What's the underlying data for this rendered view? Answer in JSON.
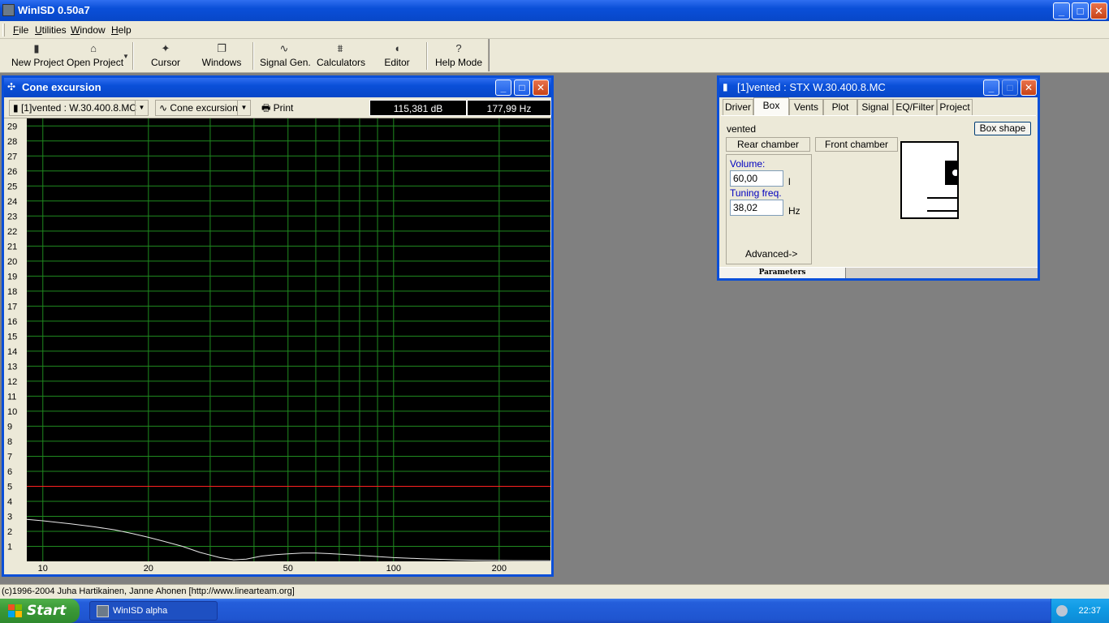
{
  "app": {
    "title": "WinISD 0.50a7",
    "min": "_",
    "max": "□",
    "close": "✕"
  },
  "menu": [
    "File",
    "Utilities",
    "Window",
    "Help"
  ],
  "toolbar": {
    "new_project": "New Project",
    "open_project": "Open Project",
    "cursor": "Cursor",
    "windows": "Windows",
    "signal_gen": "Signal Gen.",
    "calculators": "Calculators",
    "editor": "Editor",
    "help_mode": "Help Mode"
  },
  "graph_window": {
    "title": "Cone excursion",
    "project_select": "[1]vented : W.30.400.8.MC",
    "graph_select": "Cone excursion",
    "print": "Print",
    "readout_db": "115,381 dB",
    "readout_hz": "177,99 Hz"
  },
  "chart_data": {
    "type": "line",
    "title": "",
    "xlabel": "",
    "ylabel": "",
    "x_scale": "log",
    "xlim": [
      9,
      280
    ],
    "ylim": [
      0,
      29.5
    ],
    "x_ticks": [
      10,
      20,
      50,
      100,
      200
    ],
    "y_ticks": [
      1,
      2,
      3,
      4,
      5,
      6,
      7,
      8,
      9,
      10,
      11,
      12,
      13,
      14,
      15,
      16,
      17,
      18,
      19,
      20,
      21,
      22,
      23,
      24,
      25,
      26,
      27,
      28,
      29
    ],
    "grid": true,
    "background": "#000000",
    "grid_color": "#1f8a1f",
    "limit_line": {
      "y": 5,
      "color": "#ff2020"
    },
    "series": [
      {
        "color": "#e8e8e8",
        "x": [
          9,
          10,
          12,
          14,
          16,
          18,
          20,
          22,
          25,
          28,
          32,
          35,
          38,
          42,
          46,
          50,
          55,
          60,
          65,
          70,
          75,
          80,
          90,
          100,
          120,
          150,
          180,
          220,
          280
        ],
        "y": [
          2.8,
          2.7,
          2.5,
          2.3,
          2.1,
          1.85,
          1.6,
          1.35,
          1.0,
          0.6,
          0.25,
          0.1,
          0.15,
          0.35,
          0.45,
          0.5,
          0.55,
          0.55,
          0.52,
          0.48,
          0.44,
          0.4,
          0.32,
          0.25,
          0.18,
          0.1,
          0.07,
          0.05,
          0.04
        ]
      }
    ]
  },
  "box_window": {
    "title": "[1]vented : STX W.30.400.8.MC",
    "tabs": [
      "Driver",
      "Box",
      "Vents",
      "Plot",
      "Signal",
      "EQ/Filter",
      "Project"
    ],
    "active_tab": "Box",
    "box_type": "vented",
    "box_shape_button": "Box shape",
    "rear_chamber": "Rear chamber",
    "front_chamber": "Front chamber",
    "volume_label": "Volume:",
    "volume_value": "60,00",
    "volume_unit": "l",
    "tuning_label": "Tuning freq.",
    "tuning_value": "38,02",
    "tuning_unit": "Hz",
    "advanced": "Advanced->",
    "bottom_tab": "Parameters"
  },
  "statusbar": "(c)1996-2004 Juha Hartikainen, Janne Ahonen [http://www.linearteam.org]",
  "taskbar": {
    "start": "Start",
    "task": "WinISD alpha",
    "clock": "22:37"
  }
}
